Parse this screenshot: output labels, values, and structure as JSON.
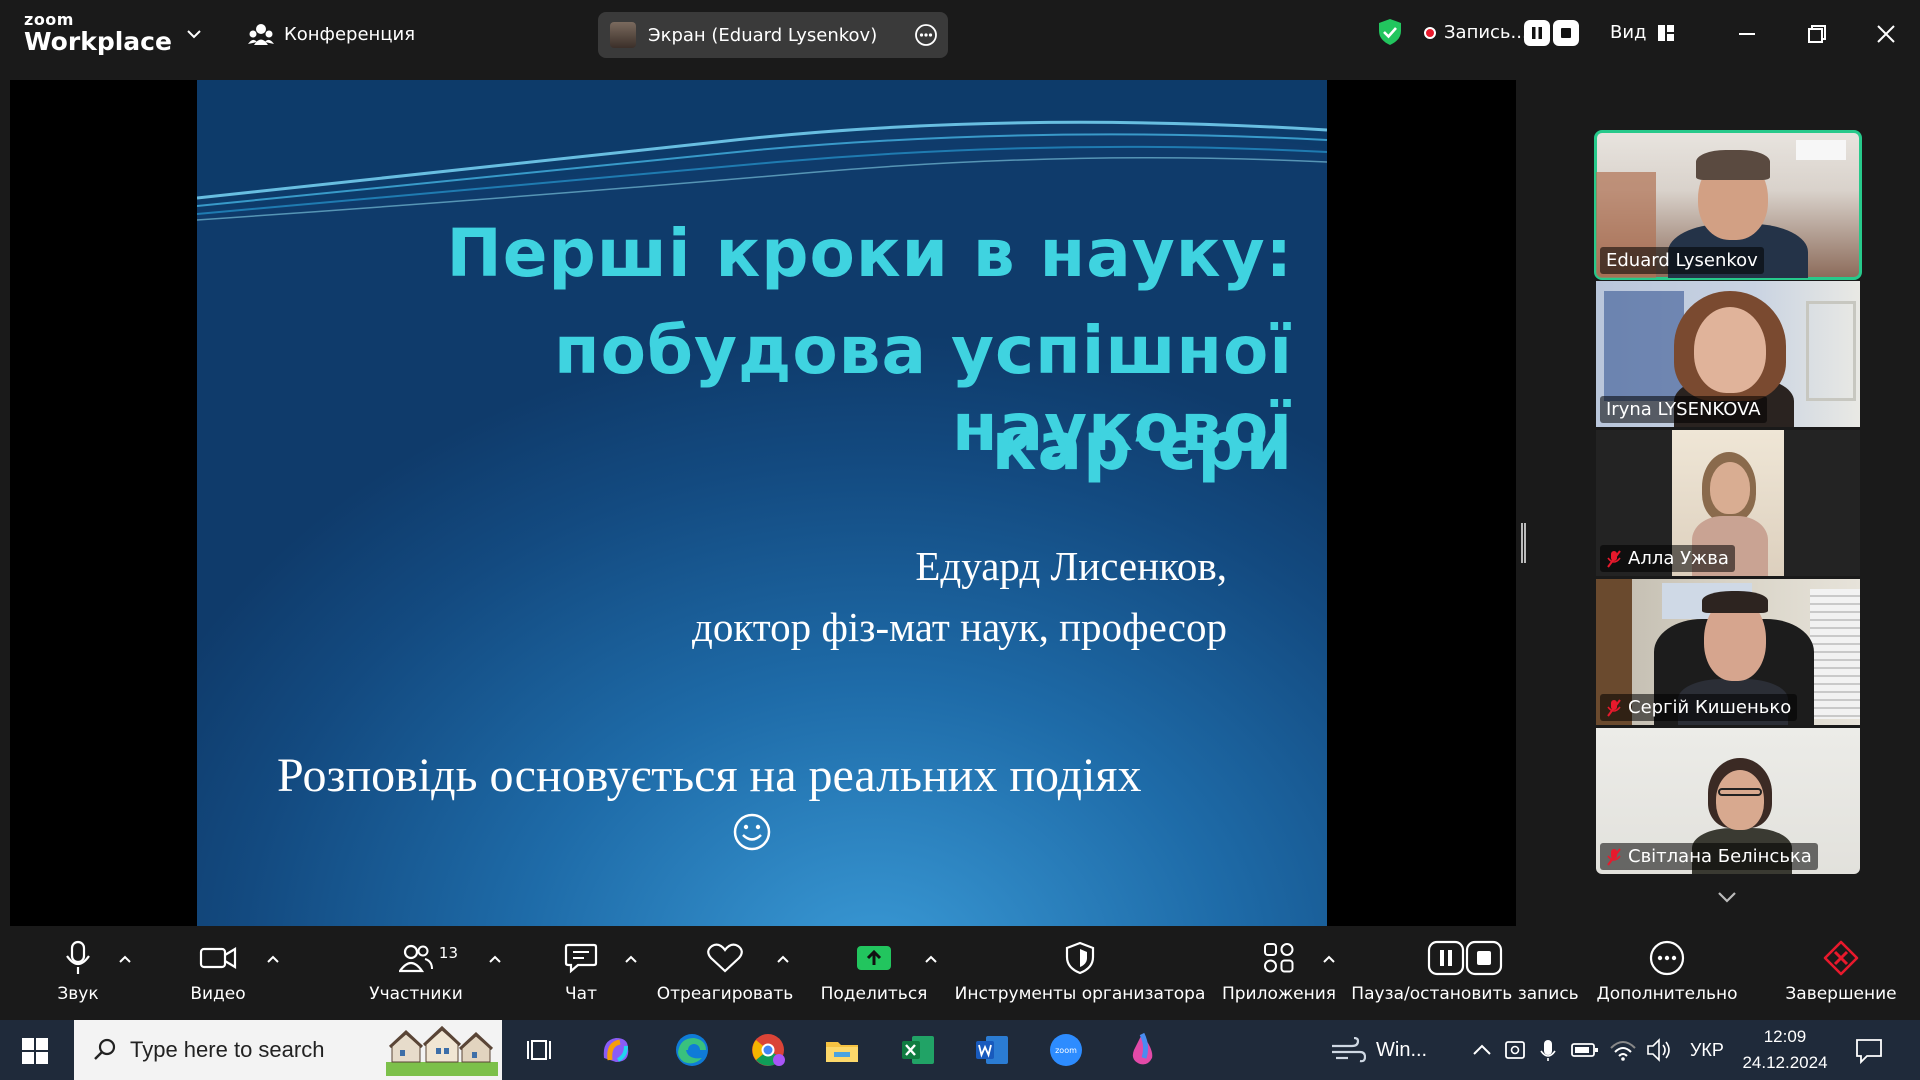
{
  "titlebar": {
    "brand_top": "zoom",
    "brand_bottom": "Workplace",
    "meeting_label": "Конференция",
    "share_label": "Экран (Eduard Lysenkov)",
    "record_label": "Запись...",
    "view_label": "Вид"
  },
  "slide": {
    "title_line1": "Перші кроки в науку:",
    "title_line2": "побудова успішної наукової",
    "title_line3": "кар’єри",
    "author_line1": "Едуард Лисенков,",
    "author_line2": "доктор фіз-мат наук, професор",
    "story": "Розповідь основується на реальних подіях",
    "title_color": "#3fd3e0"
  },
  "participants": [
    {
      "name": "Eduard Lysenkov",
      "muted": false,
      "active": true
    },
    {
      "name": "Iryna LYSENKOVA",
      "muted": false,
      "active": false
    },
    {
      "name": "Алла Ужва",
      "muted": true,
      "active": false
    },
    {
      "name": "Сергій Кишенько",
      "muted": true,
      "active": false
    },
    {
      "name": "Світлана Белінська",
      "muted": true,
      "active": false
    }
  ],
  "toolbar": {
    "audio": "Звук",
    "video": "Видео",
    "participants": "Участники",
    "participants_count": "13",
    "chat": "Чат",
    "react": "Отреагировать",
    "share": "Поделиться",
    "host_tools": "Инструменты организатора",
    "apps": "Приложения",
    "pause_record": "Пауза/остановить запись",
    "more": "Дополнительно",
    "end": "Завершение",
    "share_color": "#22c55e",
    "end_color": "#e8192c"
  },
  "taskbar": {
    "search_placeholder": "Type here to search",
    "weather_label": "Win...",
    "lang": "УКР",
    "time": "12:09",
    "date": "24.12.2024"
  }
}
